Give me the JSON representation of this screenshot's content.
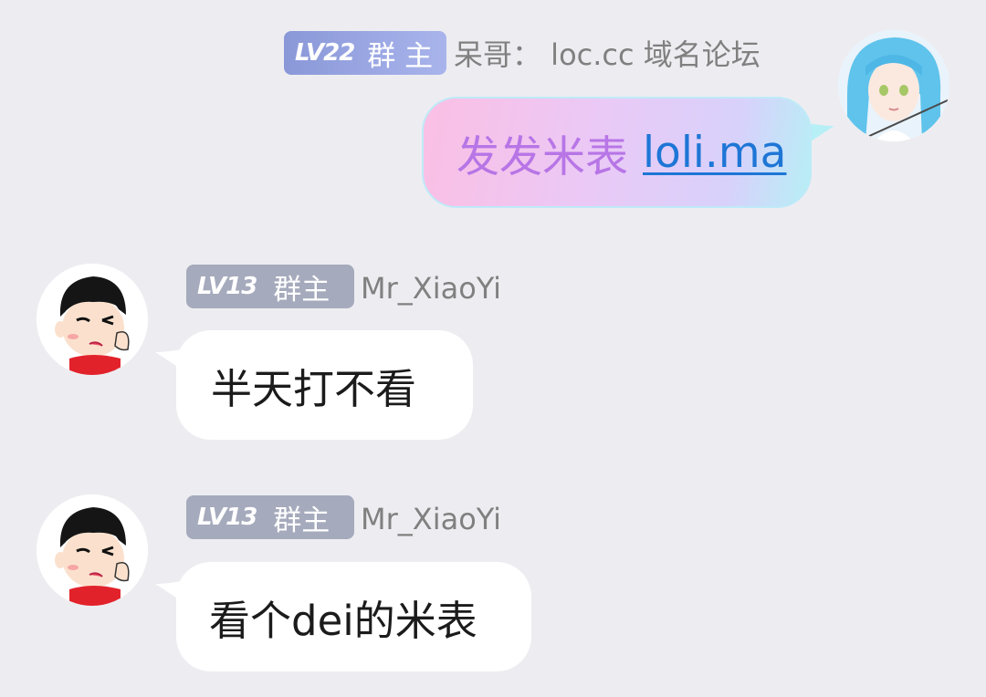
{
  "messages": [
    {
      "level": "LV22",
      "role": "群 主",
      "name": "呆哥：  loc.cc  域名论坛",
      "text": "发发米表",
      "link": "loli.ma"
    },
    {
      "level": "LV13",
      "role": "群主",
      "name": "Mr_XiaoYi",
      "text": "半天打不看"
    },
    {
      "level": "LV13",
      "role": "群主",
      "name": "Mr_XiaoYi",
      "text": "看个dei的米表"
    }
  ],
  "colors": {
    "background": "#ededf1",
    "owner_badge": "#8a98d8",
    "member_badge": "#a5aabc",
    "fancy_text": "#b775e6",
    "link": "#1e76d6"
  }
}
